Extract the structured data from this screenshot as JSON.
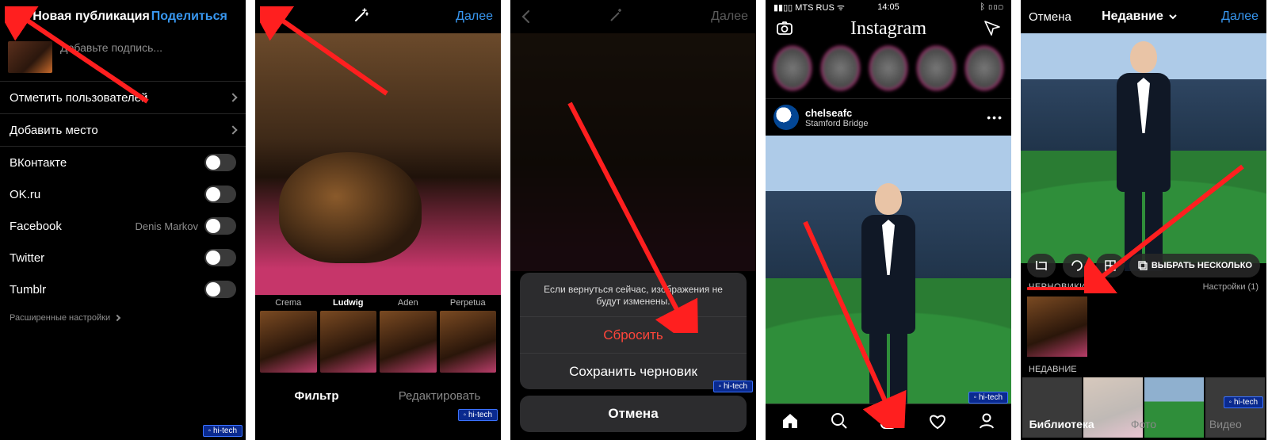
{
  "watermark": "hi-tech",
  "screen1": {
    "title": "Новая публикация",
    "action": "Поделиться",
    "caption_placeholder": "Добавьте подпись...",
    "tag_users": "Отметить пользователей",
    "add_location": "Добавить место",
    "shares": [
      {
        "name": "ВКонтакте",
        "sub": ""
      },
      {
        "name": "OK.ru",
        "sub": ""
      },
      {
        "name": "Facebook",
        "sub": "Denis Markov"
      },
      {
        "name": "Twitter",
        "sub": ""
      },
      {
        "name": "Tumblr",
        "sub": ""
      }
    ],
    "advanced": "Расширенные настройки"
  },
  "screen2": {
    "action": "Далее",
    "filters": [
      "Crema",
      "Ludwig",
      "Aden",
      "Perpetua"
    ],
    "tab_filter": "Фильтр",
    "tab_edit": "Редактировать"
  },
  "screen3": {
    "action": "Далее",
    "sheet_message": "Если вернуться сейчас, изображения не будут изменены.",
    "reset": "Сбросить",
    "save_draft": "Сохранить черновик",
    "cancel": "Отмена"
  },
  "screen4": {
    "status_left": "MTS RUS",
    "status_time": "14:05",
    "logo": "Instagram",
    "post_user": "chelseafc",
    "post_location": "Stamford Bridge"
  },
  "screen5": {
    "cancel": "Отмена",
    "title": "Недавние",
    "action": "Далее",
    "select_multiple": "ВЫБРАТЬ НЕСКОЛЬКО",
    "drafts_label": "ЧЕРНОВИКИ",
    "drafts_settings": "Настройки (1)",
    "recents_label": "НЕДАВНИЕ",
    "tab_library": "Библиотека",
    "tab_photo": "Фото",
    "tab_video": "Видео"
  }
}
